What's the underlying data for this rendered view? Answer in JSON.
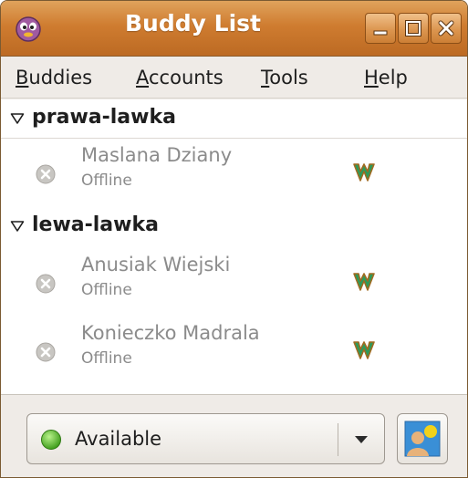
{
  "window": {
    "title": "Buddy List"
  },
  "menu": {
    "items": [
      {
        "accel": "B",
        "rest": "uddies"
      },
      {
        "accel": "A",
        "rest": "ccounts"
      },
      {
        "accel": "T",
        "rest": "ools"
      },
      {
        "accel": "H",
        "rest": "elp"
      }
    ]
  },
  "groups": [
    {
      "name": "prawa-lawka",
      "buddies": [
        {
          "name": "Maslana Dziany",
          "status": "Offline"
        }
      ]
    },
    {
      "name": "lewa-lawka",
      "buddies": [
        {
          "name": "Anusiak Wiejski",
          "status": "Offline"
        },
        {
          "name": "Konieczko Madrala",
          "status": "Offline"
        }
      ]
    }
  ],
  "status_selector": {
    "label": "Available"
  },
  "icons": {
    "app": "pidgin-icon",
    "offline": "offline-status-icon",
    "protocol": "gadu-gadu-protocol-icon",
    "available": "available-status-icon",
    "avatar": "buddy-icon"
  },
  "colors": {
    "titlebar": "#cf7c30",
    "available": "#4caf20",
    "offline_text": "#8b8b8b"
  }
}
